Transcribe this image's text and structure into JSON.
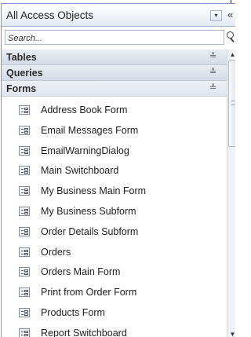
{
  "pane": {
    "title": "All Access Objects",
    "dropdown_glyph": "▾",
    "collapse_glyph": "«"
  },
  "search": {
    "placeholder": "Search..."
  },
  "groups": [
    {
      "label": "Tables",
      "chevron": "≚",
      "state": "collapsed"
    },
    {
      "label": "Queries",
      "chevron": "≚",
      "state": "collapsed"
    },
    {
      "label": "Forms",
      "chevron": "≙",
      "state": "expanded"
    }
  ],
  "forms": [
    {
      "label": "Address Book Form"
    },
    {
      "label": "Email Messages Form"
    },
    {
      "label": "EmailWarningDialog"
    },
    {
      "label": "Main Switchboard"
    },
    {
      "label": "My Business Main Form"
    },
    {
      "label": "My Business Subform"
    },
    {
      "label": "Order Details Subform"
    },
    {
      "label": "Orders"
    },
    {
      "label": "Orders Main Form"
    },
    {
      "label": "Print from Order Form"
    },
    {
      "label": "Products Form"
    },
    {
      "label": "Report Switchboard"
    }
  ],
  "scrollbar": {
    "up_glyph": "▲",
    "down_glyph": "▼"
  },
  "icons": {
    "form": "form-object-icon",
    "search": "search-icon"
  },
  "colors": {
    "pane_border": "#7a96c2",
    "group_header": "#d4dbe6"
  }
}
